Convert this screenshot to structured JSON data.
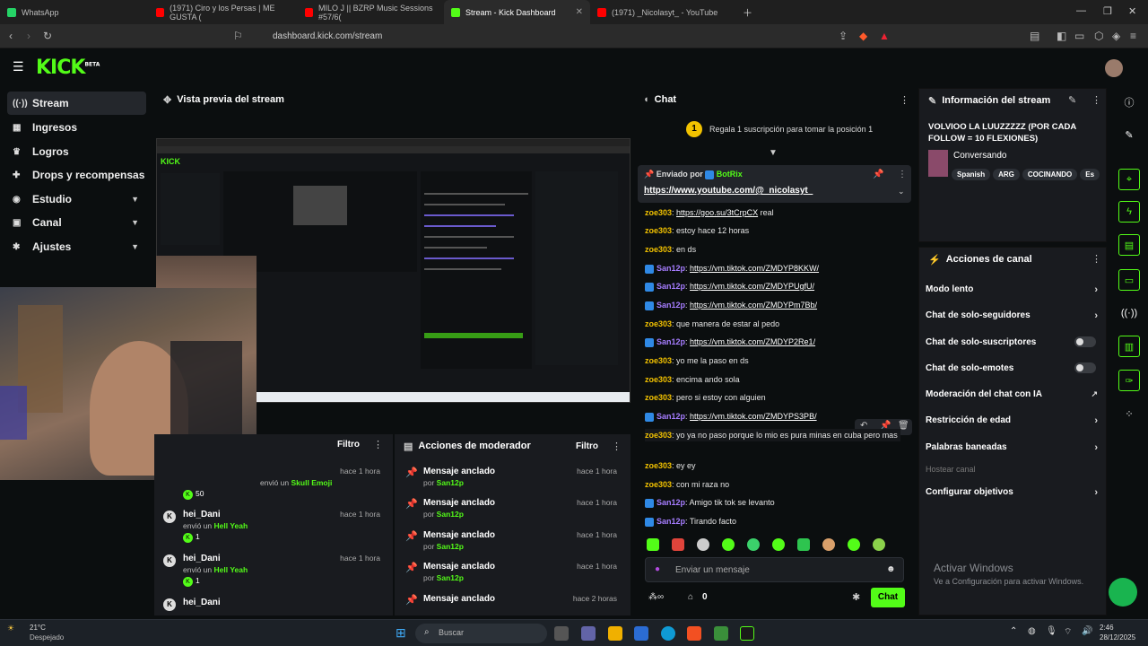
{
  "browser": {
    "tabs": [
      {
        "label": "WhatsApp",
        "color": "#25d366"
      },
      {
        "label": "(1971) Ciro y los Persas | ME GUSTA (",
        "color": "#ff0000"
      },
      {
        "label": "MILO J || BZRP Music Sessions #57/6(",
        "color": "#ff0000"
      },
      {
        "label": "Stream - Kick Dashboard",
        "color": "#53fc18"
      },
      {
        "label": "(1971) _Nicolasyt_ - YouTube",
        "color": "#ff0000"
      }
    ],
    "url": "dashboard.kick.com/stream"
  },
  "kick": {
    "logo": "KICK",
    "beta": "BETA"
  },
  "sidebar": {
    "items": [
      {
        "label": "Stream",
        "icon": "wifi-icon"
      },
      {
        "label": "Ingresos",
        "icon": "money-icon"
      },
      {
        "label": "Logros",
        "icon": "trophy-icon"
      },
      {
        "label": "Drops y recompensas",
        "icon": "gift-icon"
      },
      {
        "label": "Estudio",
        "icon": "studio-icon"
      },
      {
        "label": "Canal",
        "icon": "channel-icon"
      },
      {
        "label": "Ajustes",
        "icon": "gear-icon"
      }
    ]
  },
  "preview": {
    "title": "Vista previa del stream"
  },
  "activity": {
    "filter": "Filtro",
    "items": [
      {
        "name": "",
        "time": "hace 1 hora",
        "sub_prefix": "envió un",
        "item": "Skull Emoji",
        "amount": "50"
      },
      {
        "name": "hei_Dani",
        "time": "hace 1 hora",
        "sub_prefix": "envió un",
        "item": "Hell Yeah",
        "amount": "1"
      },
      {
        "name": "hei_Dani",
        "time": "hace 1 hora",
        "sub_prefix": "envió un",
        "item": "Hell Yeah",
        "amount": "1"
      },
      {
        "name": "hei_Dani",
        "time": "hace 1 hora",
        "sub_prefix": "",
        "item": "",
        "amount": ""
      }
    ]
  },
  "moderator": {
    "title": "Acciones de moderador",
    "filter": "Filtro",
    "items": [
      {
        "title": "Mensaje anclado",
        "by": "por",
        "user": "San12p",
        "time": "hace 1 hora"
      },
      {
        "title": "Mensaje anclado",
        "by": "por",
        "user": "San12p",
        "time": "hace 1 hora"
      },
      {
        "title": "Mensaje anclado",
        "by": "por",
        "user": "San12p",
        "time": "hace 1 hora"
      },
      {
        "title": "Mensaje anclado",
        "by": "por",
        "user": "San12p",
        "time": "hace 1 hora"
      },
      {
        "title": "Mensaje anclado",
        "by": "por",
        "user": "San12p",
        "time": "hace 2 horas"
      }
    ]
  },
  "chat": {
    "title": "Chat",
    "gift_banner": "Regala 1 suscripción para tomar la posición 1",
    "gift_number": "1",
    "pinned": {
      "sent_by": "Enviado por",
      "bot": "BotRix",
      "link": "https://www.youtube.com/@_nicolasyt_"
    },
    "messages": [
      {
        "user": "zoe303",
        "text": "",
        "link": "https://goo.su/3tCrpCX",
        "after": " real",
        "type": "u1"
      },
      {
        "user": "zoe303",
        "text": "estoy hace 12 horas",
        "link": "",
        "after": "",
        "type": "u1"
      },
      {
        "user": "zoe303",
        "text": "en ds",
        "link": "",
        "after": "",
        "type": "u1"
      },
      {
        "user": "San12p",
        "text": "",
        "link": "https://vm.tiktok.com/ZMDYP8KKW/",
        "after": "",
        "type": "u2"
      },
      {
        "user": "San12p",
        "text": "",
        "link": "https://vm.tiktok.com/ZMDYPUgfU/",
        "after": "",
        "type": "u2"
      },
      {
        "user": "San12p",
        "text": "",
        "link": "https://vm.tiktok.com/ZMDYPm7Bb/",
        "after": "",
        "type": "u2"
      },
      {
        "user": "zoe303",
        "text": "que manera de estar al pedo",
        "link": "",
        "after": "",
        "type": "u1"
      },
      {
        "user": "San12p",
        "text": "",
        "link": "https://vm.tiktok.com/ZMDYP2Re1/",
        "after": "",
        "type": "u2"
      },
      {
        "user": "zoe303",
        "text": "yo me la paso en ds",
        "link": "",
        "after": "",
        "type": "u1"
      },
      {
        "user": "zoe303",
        "text": "encima ando sola",
        "link": "",
        "after": "",
        "type": "u1"
      },
      {
        "user": "zoe303",
        "text": "pero si estoy con alguien",
        "link": "",
        "after": "",
        "type": "u1"
      },
      {
        "user": "San12p",
        "text": "",
        "link": "https://vm.tiktok.com/ZMDYPS3PB/",
        "after": "",
        "type": "u2"
      },
      {
        "user": "zoe303",
        "text": "yo ya no paso porque lo mio es pura minas en cuba pero mas",
        "link": "",
        "after": "",
        "type": "u1"
      },
      {
        "user": "zoe303",
        "text": "ey ey",
        "link": "",
        "after": "",
        "type": "u1"
      },
      {
        "user": "zoe303",
        "text": "con mi raza no",
        "link": "",
        "after": "",
        "type": "u1"
      },
      {
        "user": "San12p",
        "text": "Amigo tik tok se levanto",
        "link": "",
        "after": "",
        "type": "u2"
      },
      {
        "user": "San12p",
        "text": "Tirando facto",
        "link": "",
        "after": "",
        "type": "u2"
      }
    ],
    "input_placeholder": "Enviar un mensaje",
    "send_label": "Chat",
    "viewer_count": "0"
  },
  "stream_info": {
    "title": "Información del stream",
    "stream_title": "VOLVIOO LA LUUZZZZZ (POR CADA FOLLOW = 10 FLEXIONES)",
    "category": "Conversando",
    "tags": [
      "Spanish",
      "ARG",
      "COCINANDO",
      "Es"
    ]
  },
  "channel_actions": {
    "title": "Acciones de canal",
    "items": [
      {
        "label": "Modo lento",
        "kind": "chevron"
      },
      {
        "label": "Chat de solo-seguidores",
        "kind": "chevron"
      },
      {
        "label": "Chat de solo-suscriptores",
        "kind": "toggle"
      },
      {
        "label": "Chat de solo-emotes",
        "kind": "toggle"
      },
      {
        "label": "Moderación del chat con IA",
        "kind": "external"
      },
      {
        "label": "Restricción de edad",
        "kind": "chevron"
      },
      {
        "label": "Palabras baneadas",
        "kind": "chevron"
      },
      {
        "label": "Hostear canal",
        "kind": "disabled"
      },
      {
        "label": "Configurar objetivos",
        "kind": "chevron"
      }
    ]
  },
  "windows": {
    "activate_title": "Activar Windows",
    "activate_sub": "Ve a Configuración para activar Windows.",
    "weather_temp": "21°C",
    "weather_text": "Despejado",
    "search": "Buscar",
    "time": "2:46",
    "date": "28/12/2025"
  },
  "colors": {
    "accent": "#53fc18",
    "panel": "#191b1f",
    "bg": "#0b0e0f"
  }
}
